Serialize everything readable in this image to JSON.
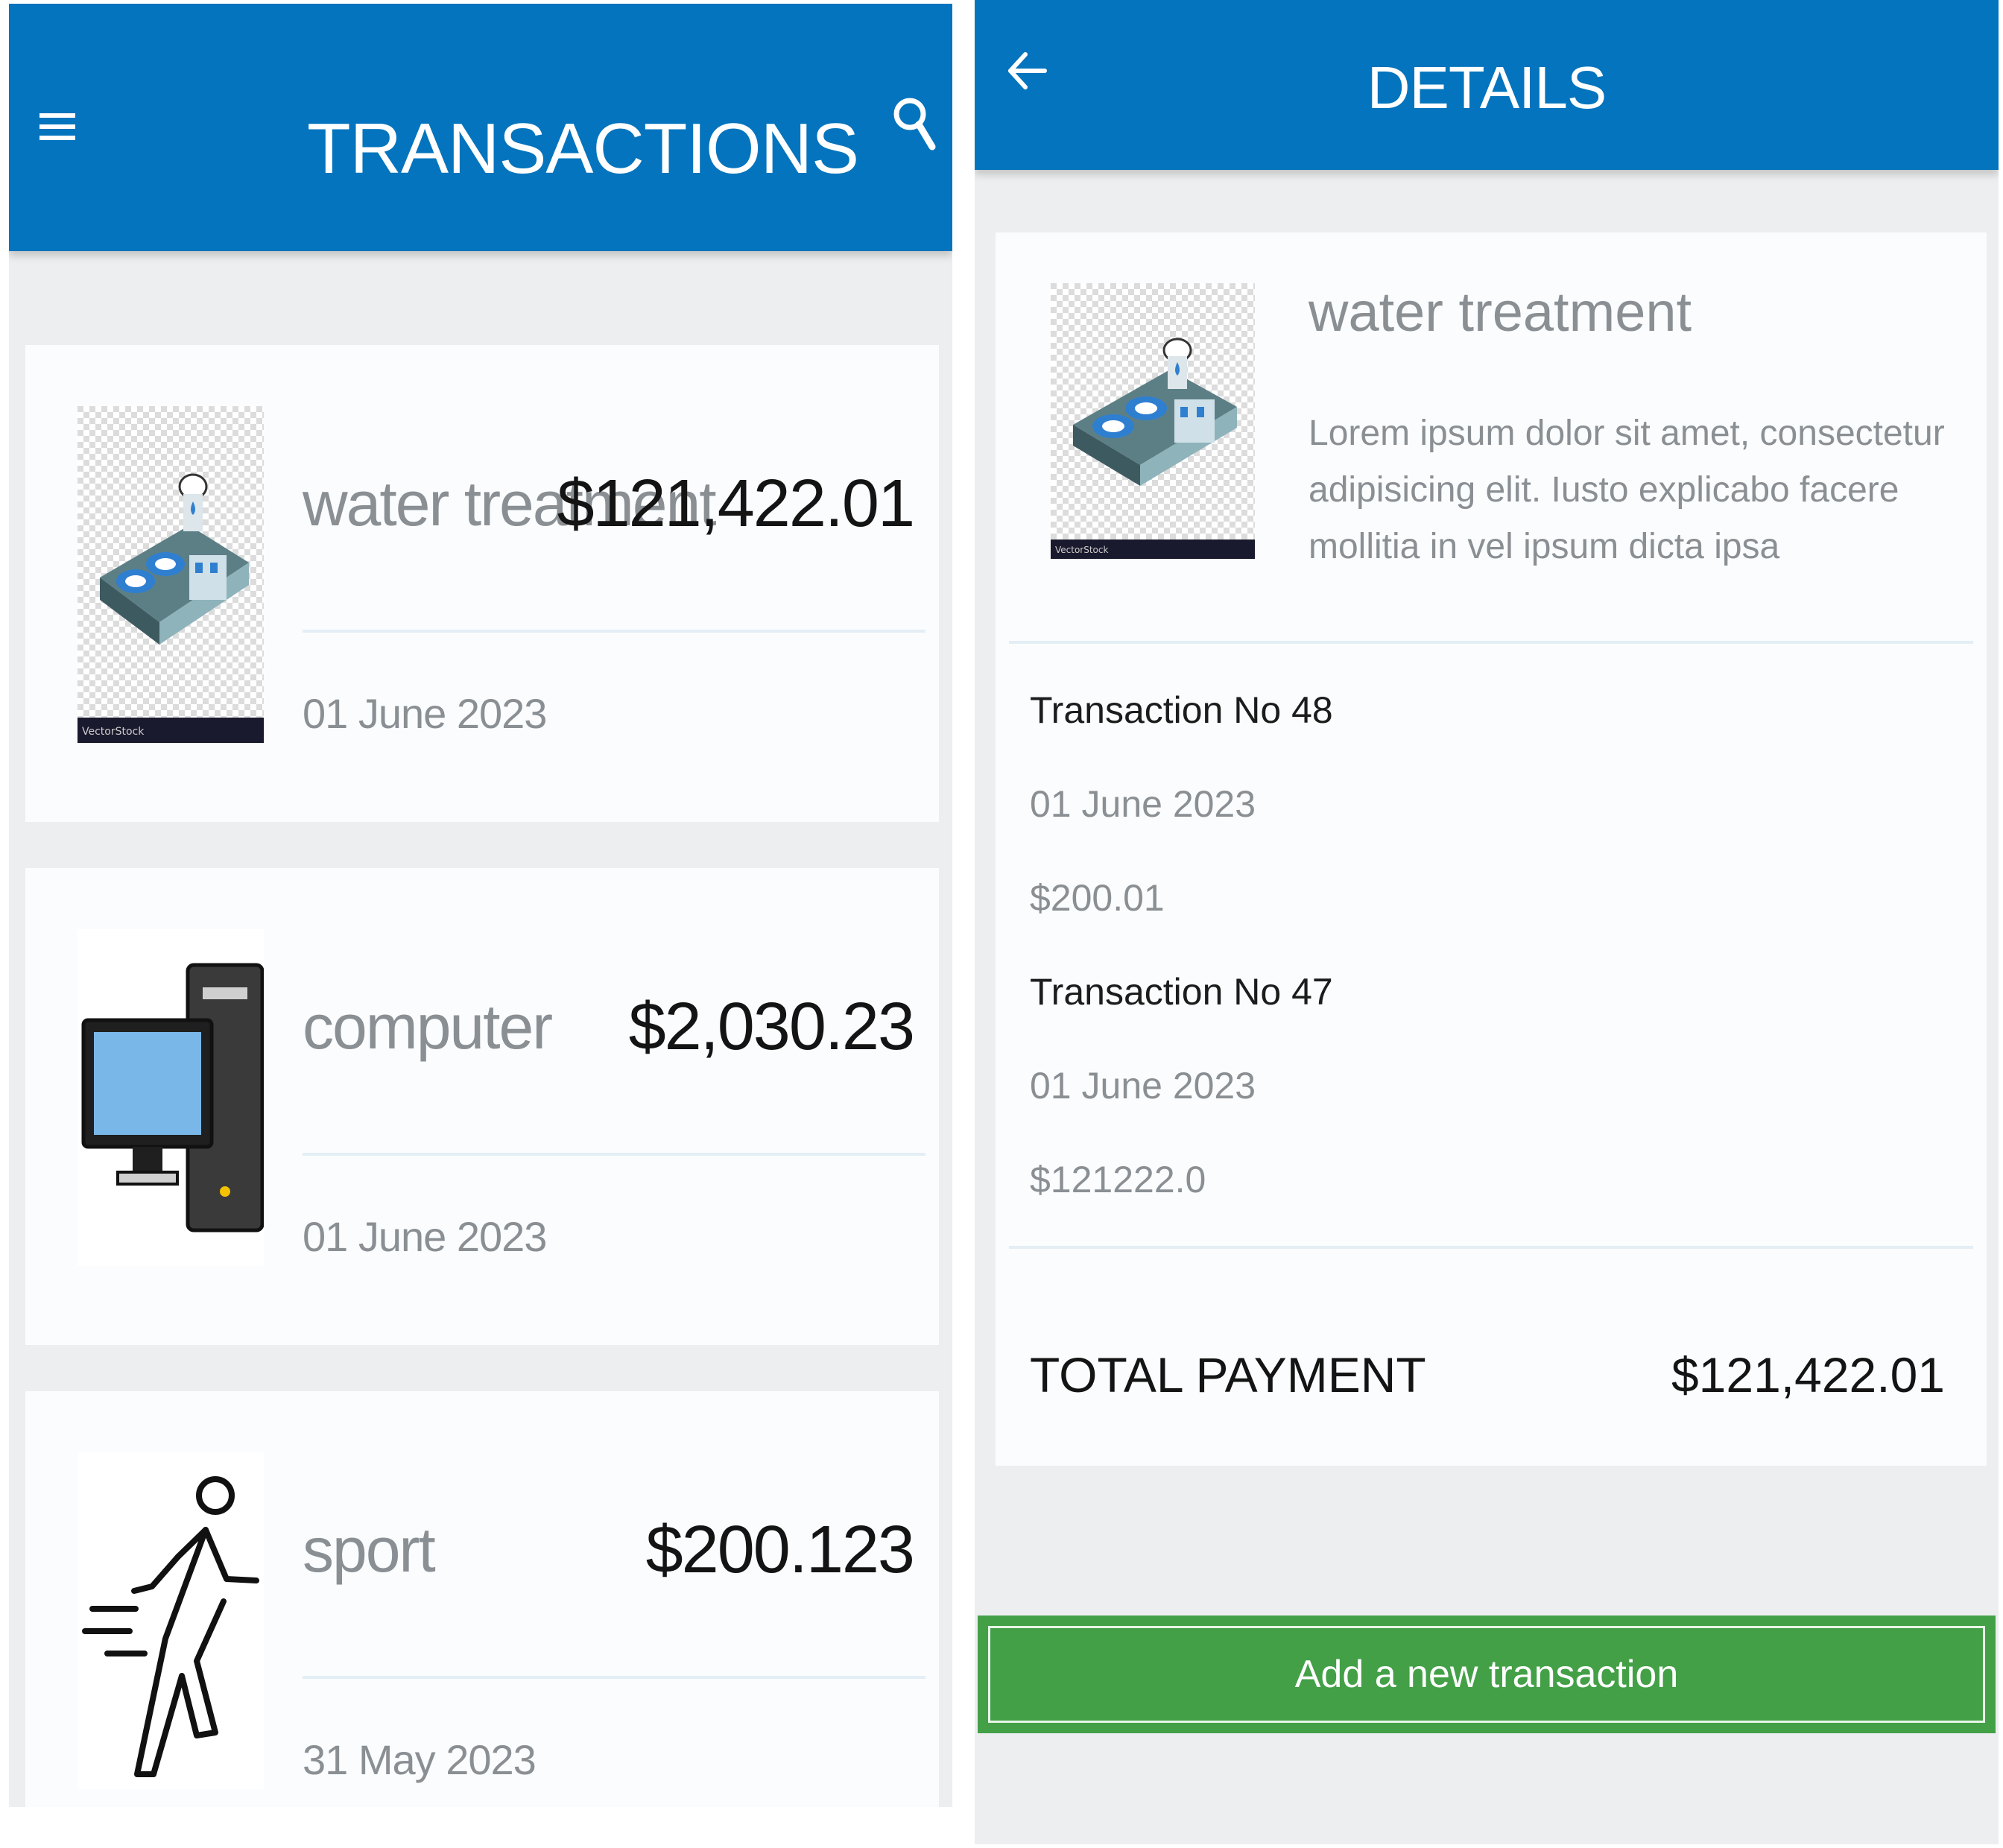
{
  "list_screen": {
    "title": "TRANSACTIONS",
    "menu_icon": "hamburger-menu-icon",
    "search_icon": "search-icon",
    "items": [
      {
        "name": "water treatment",
        "amount": "$121,422.01",
        "date": "01 June 2023",
        "icon": "water-treatment-plant-icon"
      },
      {
        "name": "computer",
        "amount": "$2,030.23",
        "date": "01 June 2023",
        "icon": "desktop-computer-icon"
      },
      {
        "name": "sport",
        "amount": "$200.123",
        "date": "31 May 2023",
        "icon": "running-person-icon"
      }
    ]
  },
  "details_screen": {
    "title": "DETAILS",
    "back_icon": "arrow-left-icon",
    "name": "water treatment",
    "description": "Lorem ipsum dolor sit amet, consectetur adipisicing elit. Iusto explicabo facere mollitia in vel ipsum dicta ipsa",
    "transactions": [
      {
        "number": "Transaction No 48",
        "date": "01 June 2023",
        "amount": "$200.01"
      },
      {
        "number": "Transaction No 47",
        "date": "01 June 2023",
        "amount": "$121222.0"
      }
    ],
    "total_label": "TOTAL PAYMENT",
    "total_value": "$121,422.01",
    "add_button_label": "Add a new transaction"
  },
  "colors": {
    "app_bar": "#0374bd",
    "background": "#eceeef",
    "card": "#fbfcfd",
    "muted_text": "#8a8f94",
    "add_button": "#43a047"
  }
}
